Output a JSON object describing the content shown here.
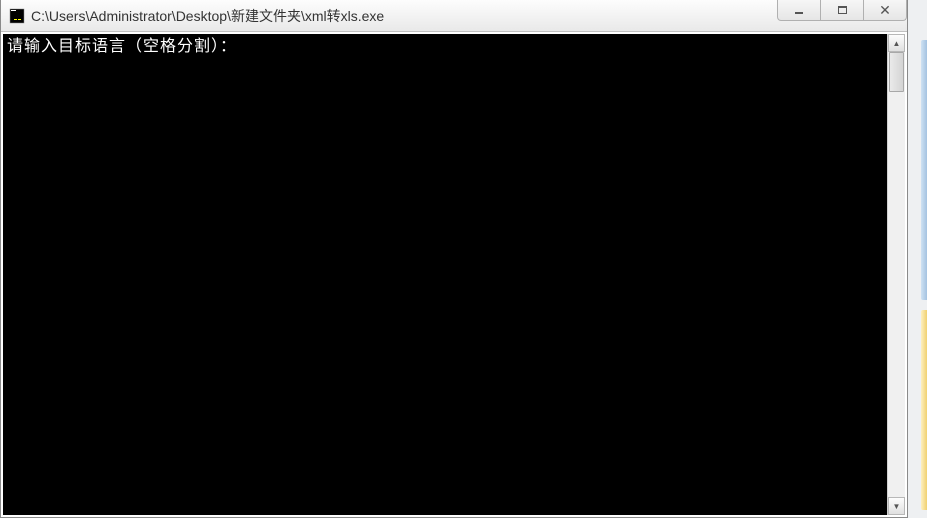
{
  "window": {
    "title": "C:\\Users\\Administrator\\Desktop\\新建文件夹\\xml转xls.exe"
  },
  "console": {
    "prompt": "请输入目标语言（空格分割）："
  },
  "controls": {
    "minimize": "minimize",
    "maximize": "maximize",
    "close": "close"
  }
}
